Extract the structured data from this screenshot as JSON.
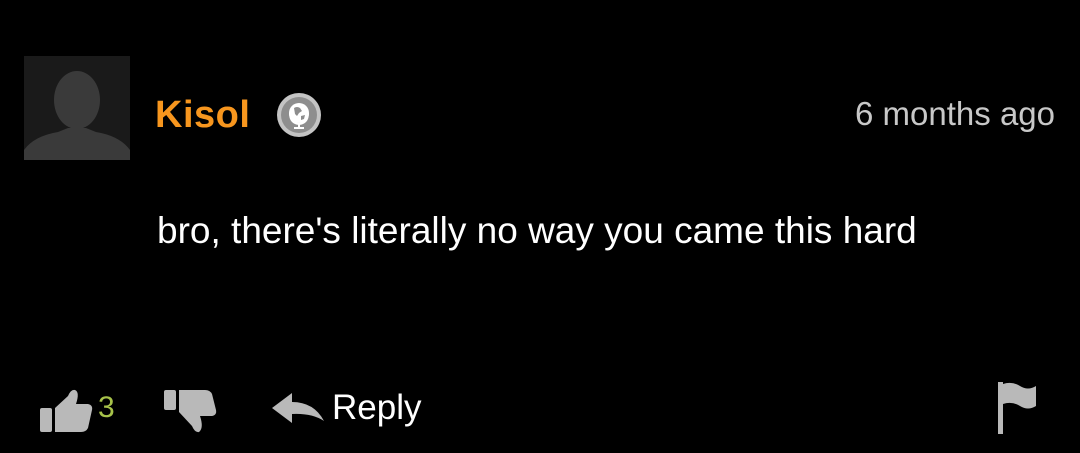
{
  "comment": {
    "username": "Kisol",
    "timestamp": "6 months ago",
    "body": "bro, there's literally no way you came this hard",
    "likes": "3",
    "reply_label": "Reply",
    "icons": {
      "avatar": "default-avatar-silhouette",
      "badge": "globe-icon",
      "like": "thumbs-up-icon",
      "dislike": "thumbs-down-icon",
      "reply": "reply-arrow-icon",
      "report": "flag-icon"
    }
  },
  "colors": {
    "background": "#000000",
    "username": "#f7961e",
    "timestamp": "#c8c8c8",
    "body_text": "#ffffff",
    "icon_gray": "#b9b9b9",
    "like_count": "#a7c24a",
    "avatar_bg": "#1a1a1a",
    "avatar_silhouette": "#3a3a3a"
  }
}
